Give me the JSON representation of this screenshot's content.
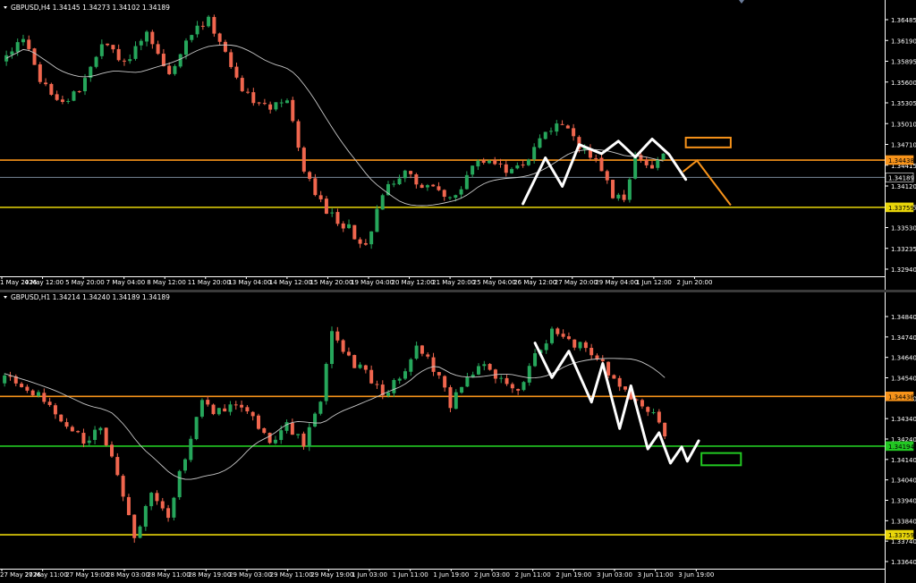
{
  "colors": {
    "background": "#000000",
    "bull": "#26a65b",
    "bear": "#f0664e",
    "ma": "#c8c8c8",
    "axis_text": "#ffffff",
    "orange": "#f7931a",
    "yellow": "#e8d50a",
    "green": "#22c822",
    "white_zigzag": "#ffffff",
    "current_price_line": "#7a8a9a"
  },
  "chart_data": [
    {
      "type": "candlestick",
      "symbol_header": "GBPUSD,H4 1.34145 1.34273 1.34102 1.34189",
      "ylim": [
        1.3282,
        1.3666
      ],
      "y_ticks": [
        "1.36485",
        "1.36190",
        "1.35895",
        "1.35600",
        "1.35305",
        "1.35010",
        "1.34710",
        "1.34415",
        "1.34120",
        "1.33825",
        "1.33530",
        "1.33235",
        "1.32940"
      ],
      "x_ticks": [
        "1 May 2026",
        "4 May 12:00",
        "5 May 20:00",
        "7 May 04:00",
        "8 May 12:00",
        "11 May 20:00",
        "13 May 04:00",
        "14 May 12:00",
        "15 May 20:00",
        "19 May 04:00",
        "20 May 12:00",
        "21 May 20:00",
        "25 May 04:00",
        "26 May 12:00",
        "27 May 20:00",
        "29 May 04:00",
        "1 Jun 12:00",
        "2 Jun 20:00"
      ],
      "candle_count": 118,
      "ma_period": 20,
      "price_labels": [
        {
          "value": 1.34438,
          "text": "1.34438",
          "style": "orange"
        },
        {
          "value": 1.34189,
          "text": "1.34189",
          "style": "current"
        },
        {
          "value": 1.33759,
          "text": "1.33759",
          "style": "yellow"
        }
      ],
      "hlines": [
        {
          "value": 1.34438,
          "color": "orange"
        },
        {
          "value": 1.33759,
          "color": "yellow"
        },
        {
          "value": 1.34189,
          "color": "current_price_line"
        }
      ],
      "zigzag": [
        [
          92,
          1.3381
        ],
        [
          96,
          1.3447
        ],
        [
          99,
          1.3406
        ],
        [
          102,
          1.3466
        ],
        [
          106,
          1.3453
        ],
        [
          109,
          1.3471
        ],
        [
          112,
          1.3448
        ],
        [
          115,
          1.3474
        ],
        [
          118,
          1.3452
        ],
        [
          121,
          1.3416
        ]
      ],
      "arrow": [
        [
          120.5,
          1.3427
        ],
        [
          123,
          1.3443
        ],
        [
          129,
          1.3379
        ]
      ],
      "zone": {
        "x0": 121,
        "x1": 129,
        "y0": 1.3462,
        "y1": 1.3476,
        "color": "orange"
      }
    },
    {
      "type": "candlestick",
      "symbol_header": "GBPUSD,H1 1.34214 1.34240 1.34189 1.34189",
      "ylim": [
        1.3361,
        1.349
      ],
      "y_ticks": [
        "1.34840",
        "1.34740",
        "1.34640",
        "1.34540",
        "1.34440",
        "1.34340",
        "1.34240",
        "1.34140",
        "1.34040",
        "1.33940",
        "1.33840",
        "1.33740",
        "1.33640"
      ],
      "x_ticks": [
        "27 May 2026",
        "27 May 11:00",
        "27 May 19:00",
        "28 May 03:00",
        "28 May 11:00",
        "28 May 19:00",
        "29 May 03:00",
        "29 May 11:00",
        "29 May 19:00",
        "1 Jun 03:00",
        "1 Jun 11:00",
        "1 Jun 19:00",
        "2 Jun 03:00",
        "2 Jun 11:00",
        "2 Jun 19:00",
        "3 Jun 03:00",
        "3 Jun 11:00",
        "3 Jun 19:00"
      ],
      "candle_count": 118,
      "ma_period": 20,
      "price_labels": [
        {
          "value": 1.34438,
          "text": "1.34438",
          "style": "orange"
        },
        {
          "value": 1.34194,
          "text": "1.34194",
          "style": "green"
        },
        {
          "value": 1.33759,
          "text": "1.33759",
          "style": "yellow"
        }
      ],
      "hlines": [
        {
          "value": 1.34438,
          "color": "orange"
        },
        {
          "value": 1.34194,
          "color": "green"
        },
        {
          "value": 1.33759,
          "color": "yellow"
        }
      ],
      "zigzag": [
        [
          94,
          1.347
        ],
        [
          97,
          1.3453
        ],
        [
          100,
          1.3466
        ],
        [
          104,
          1.3441
        ],
        [
          106,
          1.346
        ],
        [
          109,
          1.3428
        ],
        [
          111,
          1.3449
        ],
        [
          114,
          1.3418
        ],
        [
          116,
          1.3426
        ],
        [
          118,
          1.3411
        ],
        [
          120,
          1.3419
        ],
        [
          121,
          1.3412
        ],
        [
          123,
          1.3422
        ]
      ],
      "zone": {
        "x0": 123.5,
        "x1": 130.5,
        "y0": 1.341,
        "y1": 1.3416,
        "color": "green"
      }
    }
  ]
}
